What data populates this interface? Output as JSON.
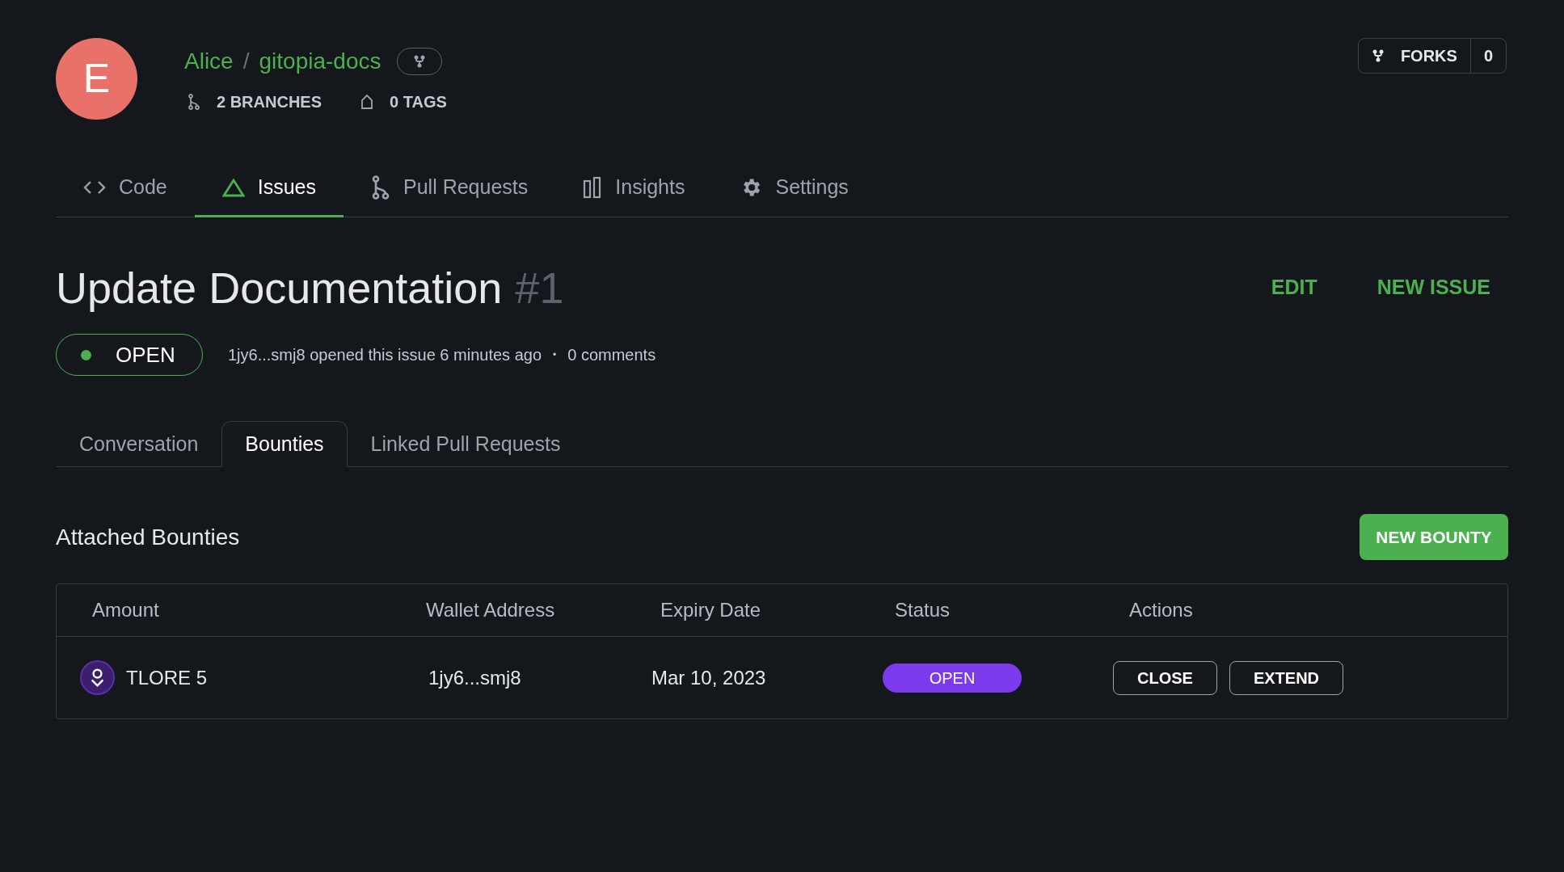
{
  "repo": {
    "avatar_letter": "E",
    "owner": "Alice",
    "separator": "/",
    "name": "gitopia-docs",
    "branches": "2 BRANCHES",
    "tags": "0 TAGS",
    "forks_label": "FORKS",
    "forks_count": "0"
  },
  "nav_tabs": [
    {
      "label": "Code",
      "kind": "code",
      "selected": false
    },
    {
      "label": "Issues",
      "kind": "issues",
      "selected": true
    },
    {
      "label": "Pull Requests",
      "kind": "pulls",
      "selected": false
    },
    {
      "label": "Insights",
      "kind": "insights",
      "selected": false
    },
    {
      "label": "Settings",
      "kind": "settings",
      "selected": false
    }
  ],
  "issue": {
    "title": "Update Documentation",
    "number": "#1",
    "actions": [
      "EDIT",
      "NEW ISSUE"
    ],
    "status": "OPEN",
    "meta": "1jy6...smj8 opened this issue 6 minutes ago",
    "separator": "•",
    "comments": "0 comments"
  },
  "issue_tabs": [
    {
      "label": "Conversation",
      "selected": false
    },
    {
      "label": "Bounties",
      "selected": true
    },
    {
      "label": "Linked Pull Requests",
      "selected": false
    }
  ],
  "bounties": {
    "heading": "Attached Bounties",
    "new_button": "NEW BOUNTY",
    "columns": [
      "Amount",
      "Wallet Address",
      "Expiry Date",
      "Status",
      "Actions"
    ],
    "rows": [
      {
        "amount": "TLORE 5",
        "wallet": "1jy6...smj8",
        "expiry": "Mar 10, 2023",
        "status": "OPEN",
        "actions": [
          "CLOSE",
          "EXTEND"
        ]
      }
    ]
  }
}
